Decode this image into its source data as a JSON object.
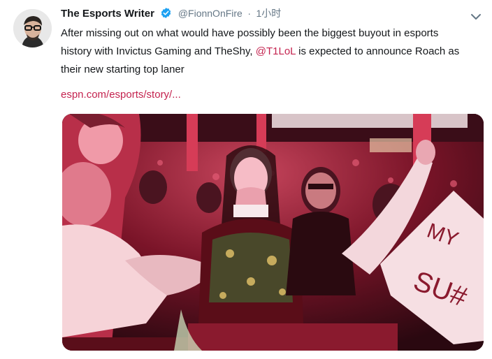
{
  "tweet": {
    "author_name": "The Esports Writer",
    "verified_icon": "verified-badge-icon",
    "handle": "@FionnOnFire",
    "separator": "·",
    "time": "1小时",
    "text_part1": "After missing out on what would have possibly been the biggest buyout in esports history with Invictus Gaming and TheShy, ",
    "mention": "@T1LoL",
    "text_part2": " is expected to announce Roach as their new starting top laner",
    "link": "espn.com/esports/story/...",
    "photo": {
      "sign_line1": "MY",
      "sign_line2": "SU#"
    }
  },
  "colors": {
    "accent": "#c4234f",
    "verified": "#1da1f2",
    "muted": "#657786"
  },
  "icons": {
    "menu": "chevron-down-icon"
  }
}
